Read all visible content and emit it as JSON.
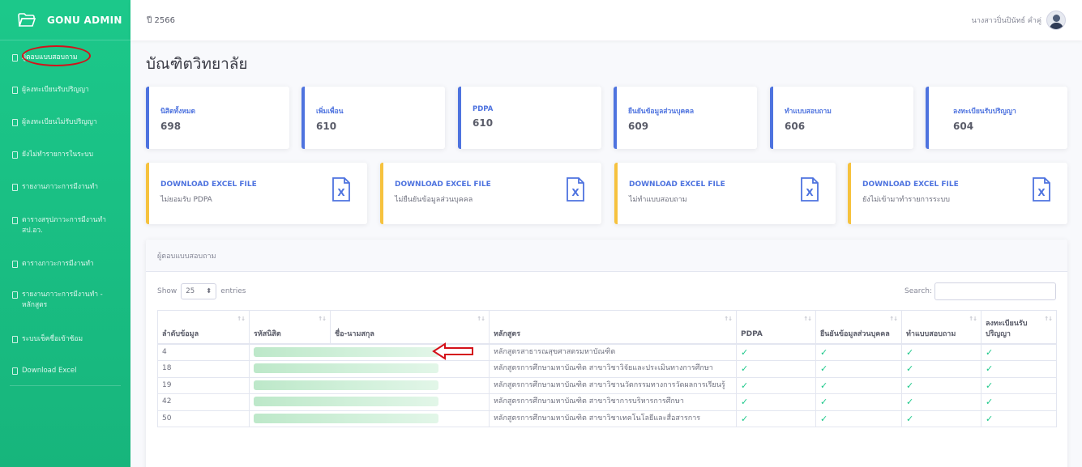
{
  "brand": {
    "name": "GONU ADMIN",
    "logo": "folder-open-icon"
  },
  "sidebar": {
    "items": [
      {
        "label": "ผู้ตอบแบบสอบถาม",
        "icon": "document-icon",
        "active": true
      },
      {
        "label": "ผู้ลงทะเบียนรับปริญญา",
        "icon": "document-icon"
      },
      {
        "label": "ผู้ลงทะเบียนไม่รับปริญญา",
        "icon": "document-icon"
      },
      {
        "label": "ยังไม่ทำรายการในระบบ",
        "icon": "document-icon"
      },
      {
        "label": "รายงานภาวะการมีงานทำ",
        "icon": "document-icon"
      },
      {
        "label": "ตารางสรุปภาวะการมีงานทำ สป.อว.",
        "icon": "document-icon"
      },
      {
        "label": "ตารางภาวะการมีงานทำ",
        "icon": "document-icon"
      },
      {
        "label": "รายงานภาวะการมีงานทำ - หลักสูตร",
        "icon": "document-icon"
      },
      {
        "label": "ระบบเช็คชื่อเข้าซ้อม",
        "icon": "document-icon"
      },
      {
        "label": "Download Excel",
        "icon": "document-icon"
      }
    ]
  },
  "topbar": {
    "year": "ปี 2566",
    "user_name": "นางสาวปิ่นปินัทธ์ คำคู่"
  },
  "page": {
    "title": "บัณฑิตวิทยาลัย"
  },
  "stats": [
    {
      "label": "นิสิตทั้งหมด",
      "value": "698"
    },
    {
      "label": "เพิ่มเพื่อน",
      "value": "610"
    },
    {
      "label": "PDPA",
      "value": "610"
    },
    {
      "label": "ยืนยันข้อมูลส่วนบุคคล",
      "value": "609"
    },
    {
      "label": "ทำแบบสอบถาม",
      "value": "606"
    },
    {
      "label": "ลงทะเบียนรับปริญญา",
      "value": "604"
    }
  ],
  "downloads": [
    {
      "title": "DOWNLOAD EXCEL FILE",
      "subtitle": "ไม่ยอมรับ PDPA"
    },
    {
      "title": "DOWNLOAD EXCEL FILE",
      "subtitle": "ไม่ยืนยันข้อมูลส่วนบุคคล"
    },
    {
      "title": "DOWNLOAD EXCEL FILE",
      "subtitle": "ไม่ทำแบบสอบถาม"
    },
    {
      "title": "DOWNLOAD EXCEL FILE",
      "subtitle": "ยังไม่เข้ามาทำรายการระบบ"
    }
  ],
  "table_card": {
    "header": "ผู้ตอบแบบสอบถาม",
    "show_label": "Show",
    "entries_value": "25",
    "entries_label": "entries",
    "search_label": "Search:",
    "search_value": "",
    "columns": [
      "ลำดับข้อมูล",
      "รหัสนิสิต",
      "ชื่อ-นามสกุล",
      "หลักสูตร",
      "PDPA",
      "ยืนยันข้อมูลส่วนบุคคล",
      "ทำแบบสอบถาม",
      "ลงทะเบียนรับปริญญา"
    ],
    "rows": [
      {
        "no": "4",
        "program": "หลักสูตรสาธารณสุขศาสตรมหาบัณฑิต",
        "check": "✓"
      },
      {
        "no": "18",
        "program": "หลักสูตรการศึกษามหาบัณฑิต สาขาวิชาวิจัยและประเมินทางการศึกษา",
        "check": "✓"
      },
      {
        "no": "19",
        "program": "หลักสูตรการศึกษามหาบัณฑิต สาขาวิชานวัตกรรมทางการวัดผลการเรียนรู้",
        "check": "✓"
      },
      {
        "no": "42",
        "program": "หลักสูตรการศึกษามหาบัณฑิต สาขาวิชาการบริหารการศึกษา",
        "check": "✓"
      },
      {
        "no": "50",
        "program": "หลักสูตรการศึกษามหาบัณฑิต สาขาวิชาเทคโนโลยีและสื่อสารการ",
        "check": "✓"
      }
    ]
  },
  "colors": {
    "sidebar": "#1cc88a",
    "primary": "#4e73df",
    "warning": "#f6c23e",
    "success": "#1cc88a",
    "annotation": "#d4111a"
  }
}
